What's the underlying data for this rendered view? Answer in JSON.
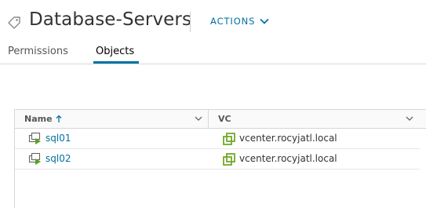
{
  "header": {
    "title": "Database-Servers",
    "actions_label": "ACTIONS",
    "title_icon": "tag-icon"
  },
  "tabs": [
    {
      "label": "Permissions",
      "active": false
    },
    {
      "label": "Objects",
      "active": true
    }
  ],
  "grid": {
    "columns": [
      {
        "label": "Name",
        "sort": "ascending"
      },
      {
        "label": "VC"
      }
    ],
    "rows": [
      {
        "name": "sql01",
        "vc": "vcenter.rocyjatl.local",
        "icon": "vm-powered-on-icon",
        "vc_icon": "vcenter-icon"
      },
      {
        "name": "sql02",
        "vc": "vcenter.rocyjatl.local",
        "icon": "vm-powered-on-icon",
        "vc_icon": "vcenter-icon"
      }
    ]
  },
  "colors": {
    "accent": "#0072a3",
    "vm_green": "#5aa220",
    "vc_green": "#74a828"
  }
}
